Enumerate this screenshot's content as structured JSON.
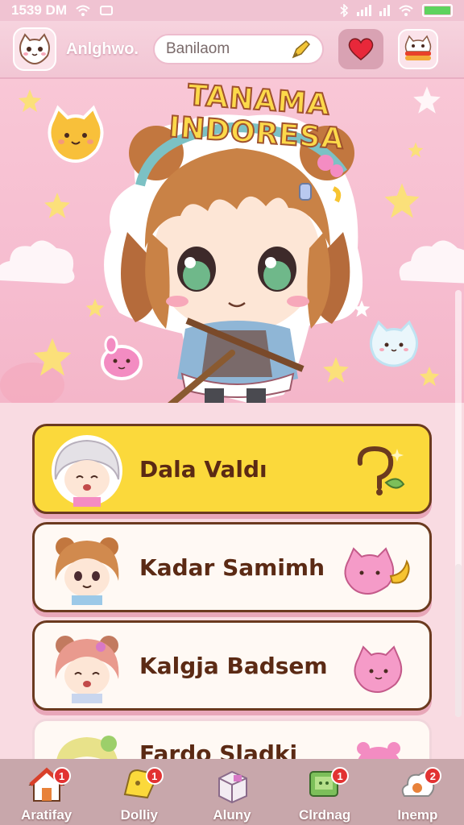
{
  "status_bar": {
    "time": "1539 DM"
  },
  "header": {
    "app_name": "Anlghwo.",
    "search_placeholder": "Banilaom"
  },
  "hero": {
    "title": "TANAMA INDORESA"
  },
  "list": {
    "items": [
      {
        "label": "Dala Valdı",
        "selected": true,
        "bg": "#fbd93b"
      },
      {
        "label": "Kadar Samimh",
        "selected": false,
        "bg": "#fff9f4"
      },
      {
        "label": "Kalgja Badsem",
        "selected": false,
        "bg": "#fff9f4"
      },
      {
        "label": "Fardo Sladki",
        "selected": false,
        "bg": "#fff9f4"
      }
    ]
  },
  "bottom_nav": {
    "items": [
      {
        "label": "Aratifay",
        "badge": "1",
        "icon": "house-icon"
      },
      {
        "label": "Dolliy",
        "badge": "1",
        "icon": "ticket-icon"
      },
      {
        "label": "Aluny",
        "badge": "",
        "icon": "box-icon"
      },
      {
        "label": "Clrdnag",
        "badge": "1",
        "icon": "chat-icon"
      },
      {
        "label": "Inemp",
        "badge": "2",
        "icon": "cloud-icon"
      }
    ]
  },
  "colors": {
    "accent": "#fbd93b",
    "pink": "#f6bdd0",
    "brown": "#6b3a1f",
    "badge": "#e23232"
  }
}
